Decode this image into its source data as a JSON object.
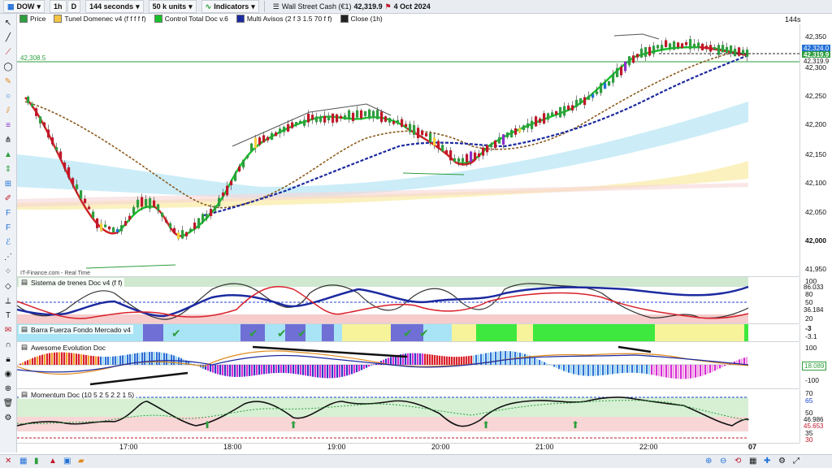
{
  "toolbar": {
    "symbol": "DOW",
    "tf_1h": "1h",
    "tf_d": "D",
    "interval": "144 seconds",
    "units": "50 k units",
    "indicators": "Indicators",
    "instrument": "Wall Street Cash (€1)",
    "last_price": "42,319.9",
    "date": "4 Oct 2024",
    "period_label": "144s"
  },
  "main_legend": {
    "price": "Price",
    "tunel": "Tunel Domenec v4 (f f f f f)",
    "control": "Control Total Doc v.6",
    "multi": "Multi Avisos (2 f 3 1.5 70 f f)",
    "close": "Close (1h)",
    "source": "IT-Finance.com - Real Time",
    "hline_label": "42,308.5"
  },
  "main_axis": {
    "ticks": [
      "42,350",
      "42,300",
      "42,250",
      "42,200",
      "42,150",
      "42,100",
      "42,050",
      "42,000",
      "41,950"
    ],
    "tag1": "42,324.0",
    "tag2": "42,319.9",
    "tag3": "42,319.9"
  },
  "panes": {
    "trenes": {
      "title": "Sistema de trenes Doc v4 (f f)",
      "ticks": [
        "100",
        "86.033",
        "80",
        "50",
        "36.184",
        "20"
      ]
    },
    "barra": {
      "title": "Barra Fuerza Fondo Mercado v4",
      "ticks": [
        "-3",
        "-3.1"
      ]
    },
    "awesome": {
      "title": "Awesome Evolution Doc",
      "ticks": [
        "100",
        "18.089",
        "-100"
      ]
    },
    "momentum": {
      "title": "Momentum Doc (10 5 2 5 2 2 1 5)",
      "ticks": [
        "70",
        "65",
        "50",
        "46.986",
        "45.653",
        "35",
        "30"
      ]
    }
  },
  "time_axis": [
    "17:00",
    "18:00",
    "19:00",
    "20:00",
    "21:00",
    "22:00",
    "07"
  ],
  "colors": {
    "bull": "#2e9e3e",
    "bear": "#c0182a",
    "trend_green": "#17c02a",
    "trend_red": "#d9202a",
    "navy": "#1c2aa0",
    "brown": "#8a5a1c",
    "accent_blue": "#1f6fd6"
  }
}
